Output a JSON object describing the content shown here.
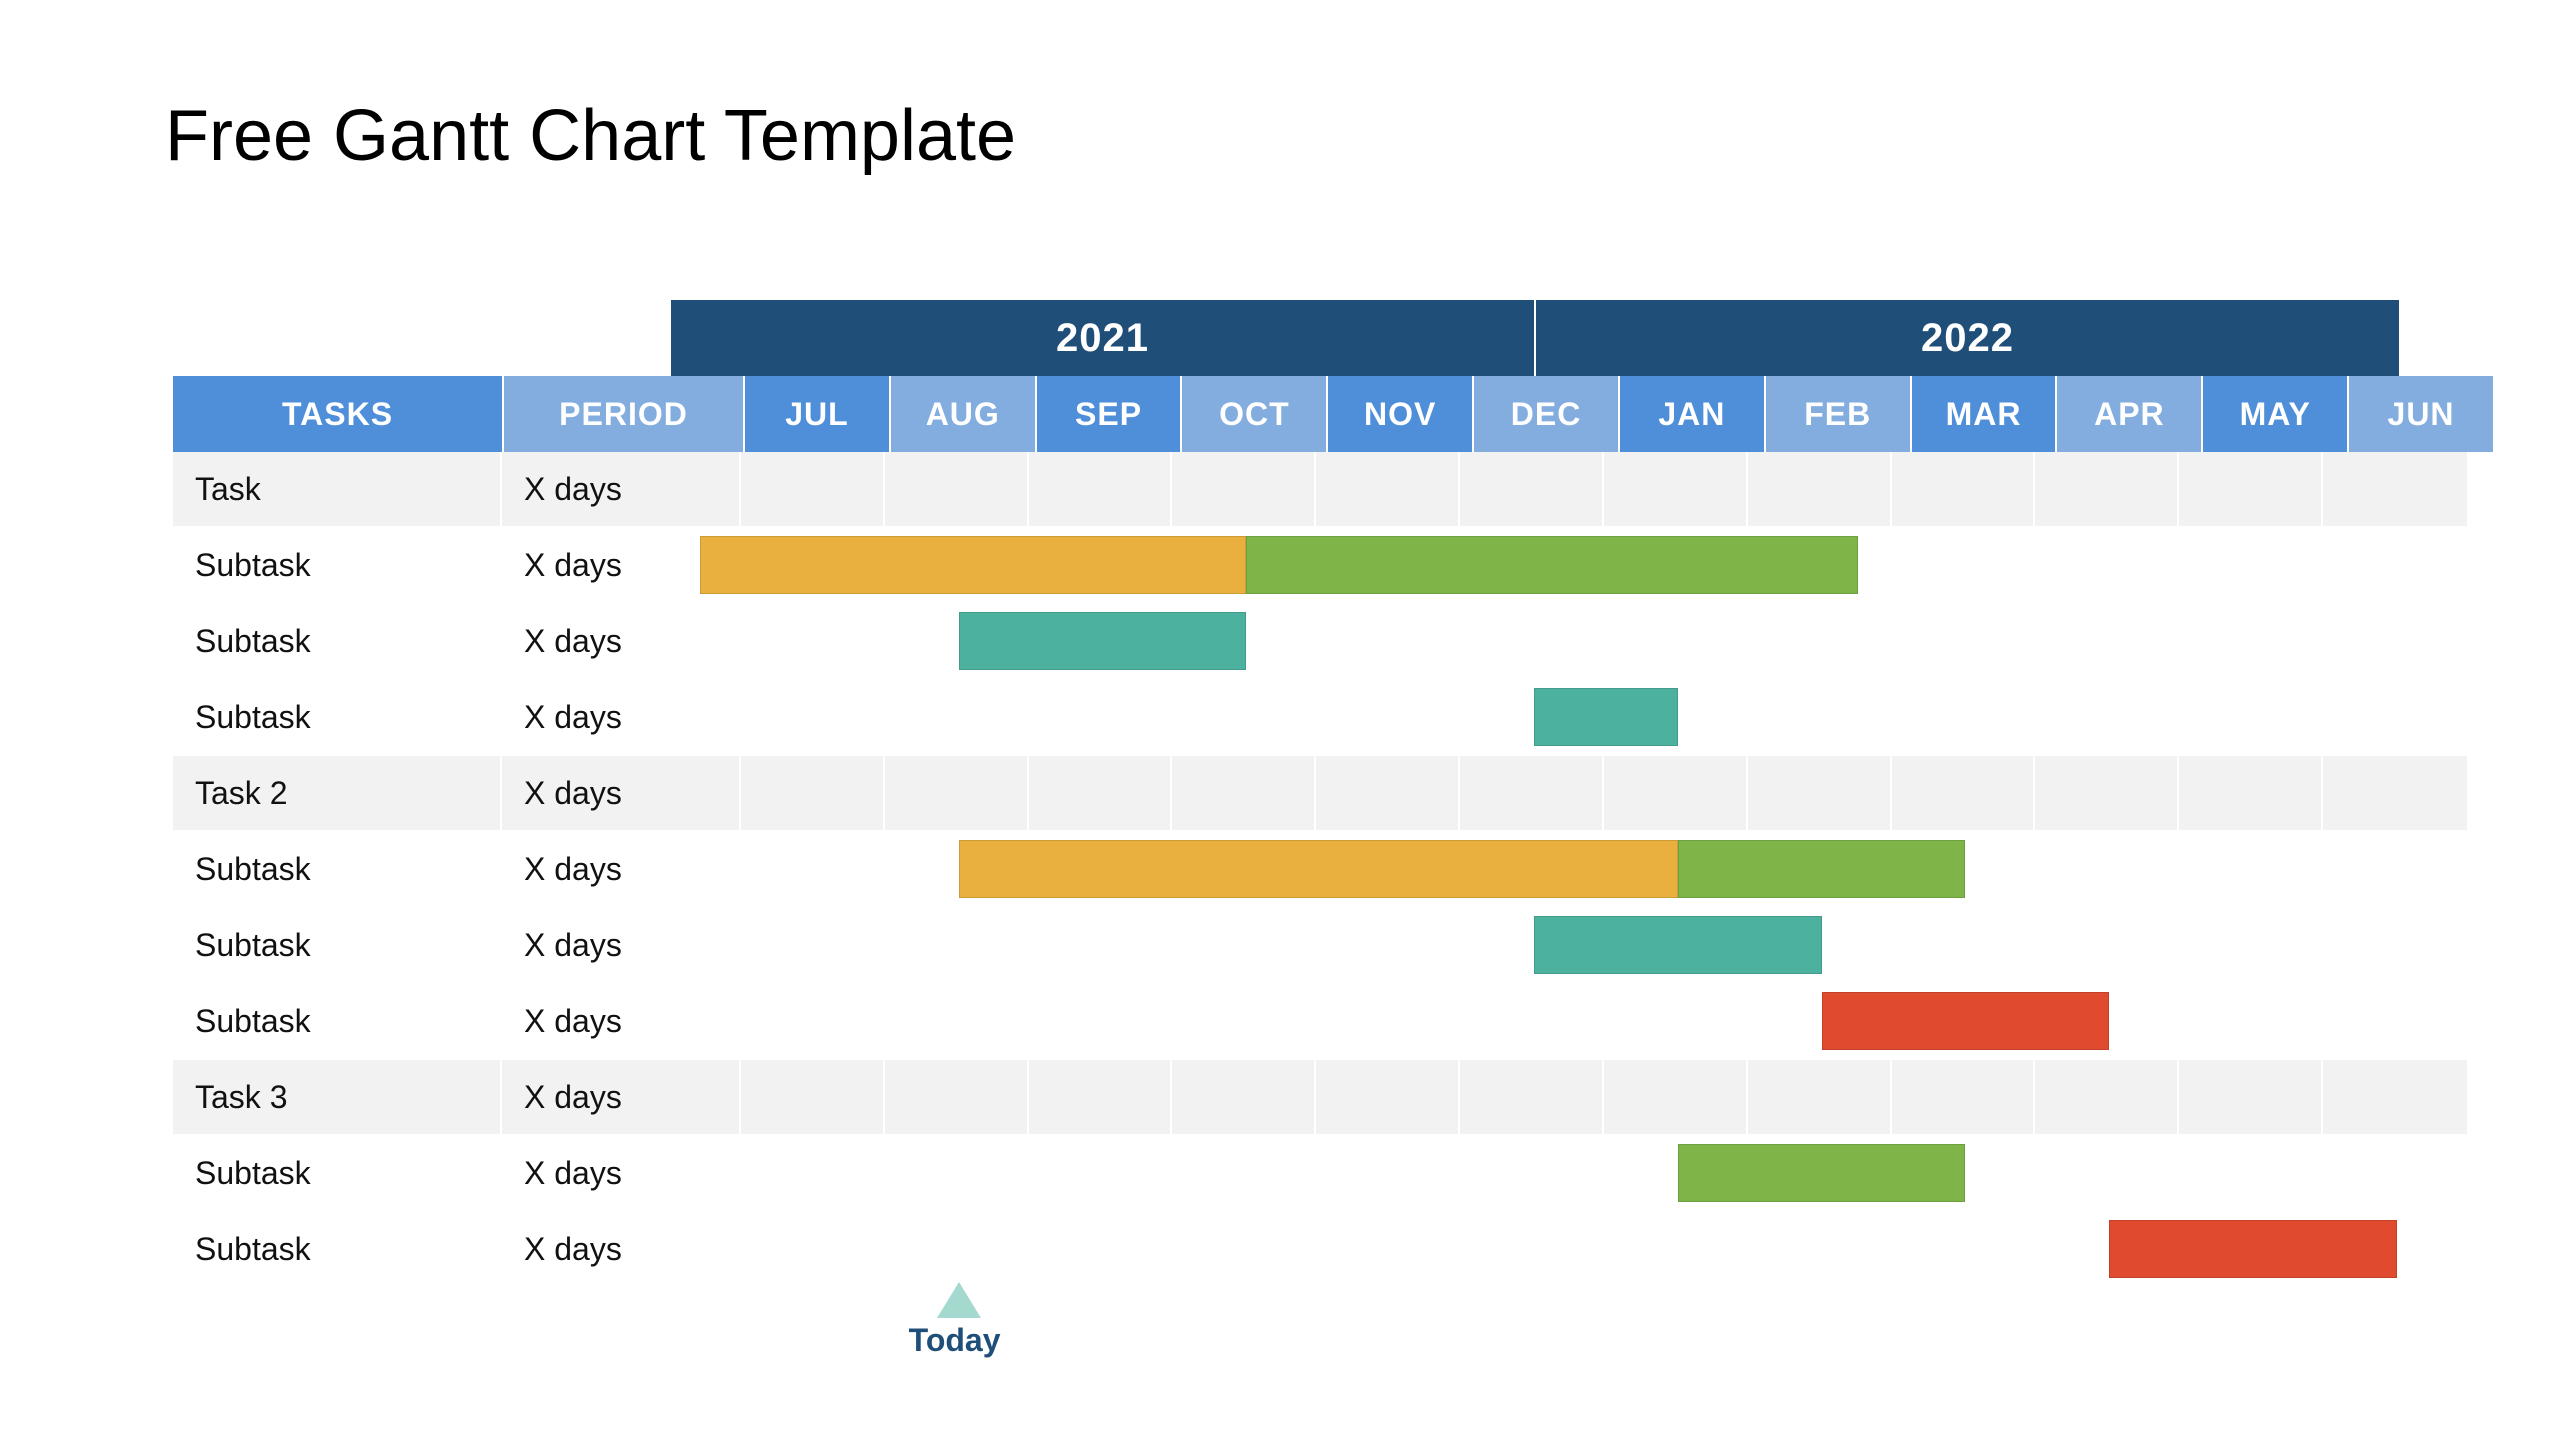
{
  "title": "Free Gantt Chart Template",
  "headers": {
    "tasks": "TASKS",
    "period": "PERIOD"
  },
  "years": [
    {
      "label": "2021",
      "span": 6
    },
    {
      "label": "2022",
      "span": 6
    }
  ],
  "months": [
    "JUL",
    "AUG",
    "SEP",
    "OCT",
    "NOV",
    "DEC",
    "JAN",
    "FEB",
    "MAR",
    "APR",
    "MAY",
    "JUN"
  ],
  "rows": [
    {
      "name": "Task",
      "period": "X days",
      "group": true
    },
    {
      "name": "Subtask",
      "period": "X days",
      "group": false
    },
    {
      "name": "Subtask",
      "period": "X days",
      "group": false
    },
    {
      "name": "Subtask",
      "period": "X days",
      "group": false
    },
    {
      "name": "Task 2",
      "period": "X days",
      "group": true
    },
    {
      "name": "Subtask",
      "period": "X days",
      "group": false
    },
    {
      "name": "Subtask",
      "period": "X days",
      "group": false
    },
    {
      "name": "Subtask",
      "period": "X days",
      "group": false
    },
    {
      "name": "Task 3",
      "period": "X days",
      "group": true
    },
    {
      "name": "Subtask",
      "period": "X days",
      "group": false
    },
    {
      "name": "Subtask",
      "period": "X days",
      "group": false
    }
  ],
  "today": {
    "label": "Today",
    "monthIndex": 2
  },
  "chart_data": {
    "type": "gantt",
    "time_axis": [
      "2021-07",
      "2021-08",
      "2021-09",
      "2021-10",
      "2021-11",
      "2021-12",
      "2022-01",
      "2022-02",
      "2022-03",
      "2022-04",
      "2022-05",
      "2022-06"
    ],
    "today_marker": "2021-09",
    "rows": [
      {
        "label": "Task",
        "period": "X days",
        "is_group": true,
        "bars": []
      },
      {
        "label": "Subtask",
        "period": "X days",
        "is_group": false,
        "bars": [
          {
            "start": 0.2,
            "end": 4.0,
            "color": "orange"
          },
          {
            "start": 4.0,
            "end": 8.25,
            "color": "green"
          }
        ]
      },
      {
        "label": "Subtask",
        "period": "X days",
        "is_group": false,
        "bars": [
          {
            "start": 2.0,
            "end": 4.0,
            "color": "teal"
          }
        ]
      },
      {
        "label": "Subtask",
        "period": "X days",
        "is_group": false,
        "bars": [
          {
            "start": 6.0,
            "end": 7.0,
            "color": "teal"
          }
        ]
      },
      {
        "label": "Task 2",
        "period": "X days",
        "is_group": true,
        "bars": []
      },
      {
        "label": "Subtask",
        "period": "X days",
        "is_group": false,
        "bars": [
          {
            "start": 2.0,
            "end": 7.0,
            "color": "orange"
          },
          {
            "start": 7.0,
            "end": 9.0,
            "color": "green"
          }
        ]
      },
      {
        "label": "Subtask",
        "period": "X days",
        "is_group": false,
        "bars": [
          {
            "start": 6.0,
            "end": 8.0,
            "color": "teal"
          }
        ]
      },
      {
        "label": "Subtask",
        "period": "X days",
        "is_group": false,
        "bars": [
          {
            "start": 8.0,
            "end": 10.0,
            "color": "red"
          }
        ]
      },
      {
        "label": "Task 3",
        "period": "X days",
        "is_group": true,
        "bars": []
      },
      {
        "label": "Subtask",
        "period": "X days",
        "is_group": false,
        "bars": [
          {
            "start": 7.0,
            "end": 9.0,
            "color": "green"
          }
        ]
      },
      {
        "label": "Subtask",
        "period": "X days",
        "is_group": false,
        "bars": [
          {
            "start": 10.0,
            "end": 12.0,
            "color": "red"
          }
        ]
      }
    ],
    "color_legend": {
      "orange": "#e9b040",
      "green": "#7fb548",
      "teal": "#4db1a0",
      "red": "#e04b2f"
    }
  }
}
